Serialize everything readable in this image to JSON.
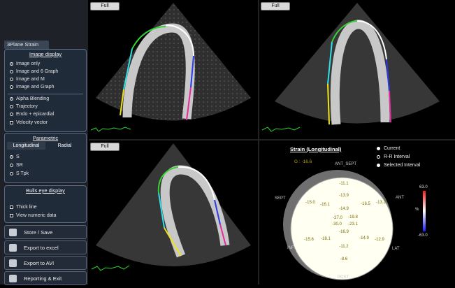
{
  "panel": {
    "tab": "3Plane Strain",
    "image_display": {
      "title": "Image display",
      "options": [
        "Image only",
        "Image and 6 Graph",
        "Image and M",
        "Image and Graph"
      ],
      "overlay_options": [
        "Alpha Blending",
        "Trajectory",
        "Endo + epicardial"
      ],
      "velocity_vector": "Velocity vector"
    },
    "parametric": {
      "title": "Parametric",
      "tabs": [
        "Longitudinal",
        "Radial"
      ],
      "options": [
        "S",
        "SR",
        "S Tpk"
      ]
    },
    "bulls_eye": {
      "title": "Bulls eye display",
      "checks": [
        "Thick line",
        "View numeric data"
      ]
    },
    "actions": [
      "Store / Save",
      "Export to excel",
      "Export to AVI",
      "Reporting & Exit"
    ]
  },
  "views": {
    "full_label": "Full"
  },
  "strain": {
    "title": "Strain (Longitudinal)",
    "global": "G : -16.6",
    "legend": [
      "Current",
      "R-R Interval",
      "Selected Interval"
    ],
    "scale_max": "63.0",
    "scale_min": "-63.0",
    "scale_unit": "%",
    "segment_labels": {
      "ant_sept": "ANT_SEPT",
      "sept": "SEPT",
      "ant": "ANT",
      "inf": "INF",
      "lat": "LAT",
      "post": "POST"
    },
    "segments": [
      "-11.1",
      "-13.9",
      "-15.0",
      "-16.1",
      "-16.5",
      "-13.2",
      "-14.9",
      "-27.0",
      "-19.8",
      "-30.0",
      "-23.1",
      "-16.9",
      "-15.6",
      "-18.1",
      "-11.2",
      "-14.9",
      "-12.9",
      "-8.6"
    ]
  },
  "colors": {
    "panel_bg": "#1e2128",
    "group_bg": "#202b3a",
    "border": "#5b6b82",
    "value_text": "#7a6a00"
  }
}
